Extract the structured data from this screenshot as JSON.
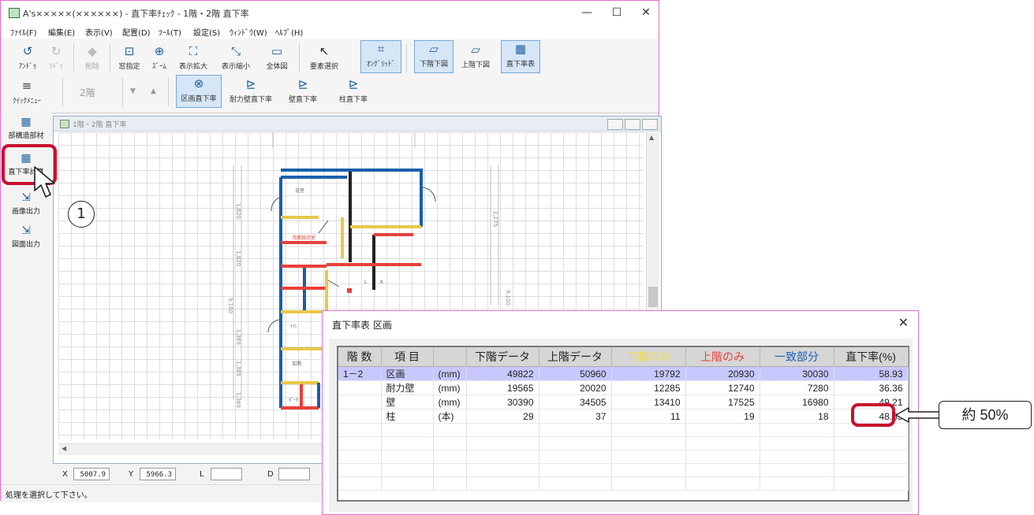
{
  "window": {
    "title": "A's×××××(××××××) - 直下率ﾁｪｯｸ - 1階・2階 直下率",
    "controls": {
      "minimize": "—",
      "maximize": "☐",
      "close": "✕"
    }
  },
  "menu": [
    "ﾌｧｲﾙ(F)",
    "編集(E)",
    "表示(V)",
    "配置(D)",
    "ﾂｰﾙ(T)",
    "設定(S)",
    "ｳｨﾝﾄﾞｳ(W)",
    "ﾍﾙﾌﾟ(H)"
  ],
  "toolbar": {
    "undo": "ｱﾝﾄﾞｩ",
    "redo": "ﾘﾄﾞｩ",
    "delete": "削除",
    "window_fit": "窓指定",
    "zoom": "ｽﾞｰﾑ",
    "zoom_in": "表示拡大",
    "zoom_out": "表示縮小",
    "whole": "全体図",
    "select": "要素選択",
    "on_grid": "ｵﾝｸﾞﾘｯﾄﾞ",
    "lower_floor": "下階下図",
    "upper_floor": "上階下図",
    "direct_table": "直下率表",
    "quick_menu": "ｸｲｯｸﾒﾆｭｰ",
    "floor": "2階",
    "tab_section": "区画直下率",
    "tab_bearing_wall": "耐力壁直下率",
    "tab_wall": "壁直下率",
    "tab_column": "柱直下率"
  },
  "sidebar": {
    "parts": "部構造部材",
    "calc": "直下率計算",
    "image_out": "画像出力",
    "drawing_out": "図面出力"
  },
  "child_window": {
    "title": "1階・2階 直下率"
  },
  "drawing": {
    "dims_left": [
      "1,820",
      "1,820",
      "9,100",
      "1,365",
      "1,365",
      "1,365"
    ],
    "dims_right": [
      "2,275",
      "9,100"
    ],
    "rooms": [
      "浴室",
      "洗面脱衣室",
      "ﾄｲﾚ",
      "玄関",
      "ﾎﾟｰﾁ",
      "L",
      "K"
    ]
  },
  "coords": {
    "x_label": "X",
    "x": "5007.9",
    "y_label": "Y",
    "y": "5966.3",
    "l_label": "L",
    "d_label": "D"
  },
  "status": "処理を選択して下さい。",
  "callout": {
    "number": "1"
  },
  "dialog": {
    "title": "直下率表  区画",
    "close": "✕",
    "headers": [
      "階 数",
      "項 目",
      "",
      "下階データ",
      "上階データ",
      "下階のみ",
      "上階のみ",
      "一致部分",
      "直下率(%)"
    ],
    "header_colors": {
      "lower_only": "#f0dc46",
      "upper_only": "#e8403a",
      "match": "#1a62b5"
    },
    "rows": [
      {
        "floor": "1－2",
        "item": "区画",
        "unit": "(mm)",
        "lower": "49822",
        "upper": "50960",
        "lower_only": "19792",
        "upper_only": "20930",
        "match": "30030",
        "ratio": "58.93"
      },
      {
        "floor": "",
        "item": "耐力壁",
        "unit": "(mm)",
        "lower": "19565",
        "upper": "20020",
        "lower_only": "12285",
        "upper_only": "12740",
        "match": "7280",
        "ratio": "36.36"
      },
      {
        "floor": "",
        "item": "壁",
        "unit": "(mm)",
        "lower": "30390",
        "upper": "34505",
        "lower_only": "13410",
        "upper_only": "17525",
        "match": "16980",
        "ratio": "49.21"
      },
      {
        "floor": "",
        "item": "柱",
        "unit": "(本)",
        "lower": "29",
        "upper": "37",
        "lower_only": "11",
        "upper_only": "19",
        "match": "18",
        "ratio": "48.65"
      }
    ]
  },
  "annotation": "約 50%"
}
